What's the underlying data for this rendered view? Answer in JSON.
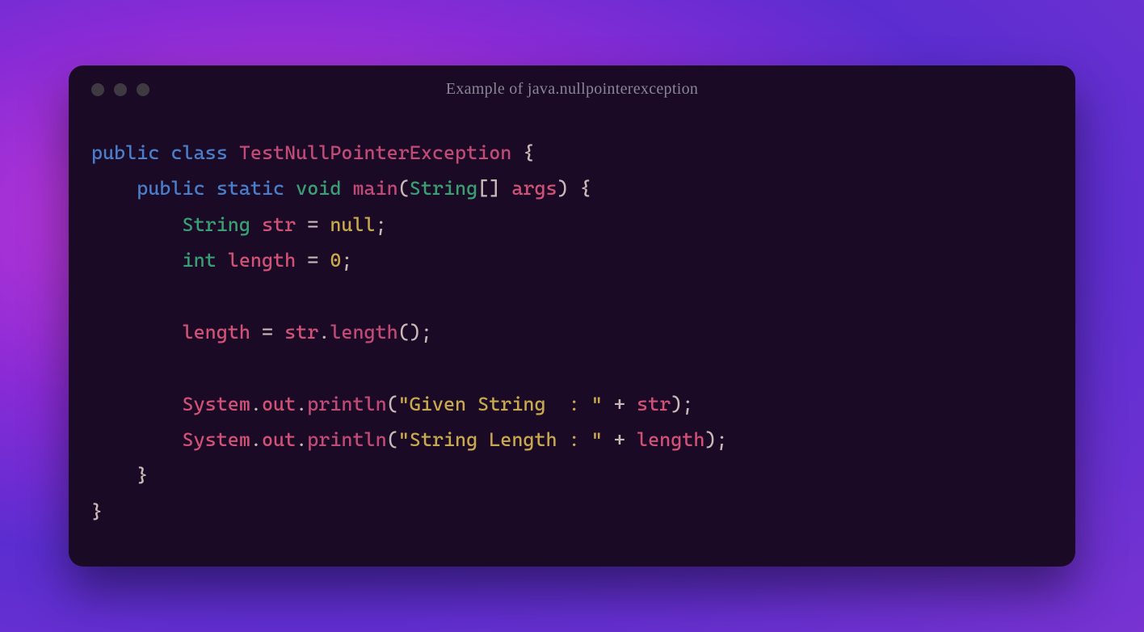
{
  "window": {
    "title": "Example of java.nullpointerexception"
  },
  "code": {
    "tokens": [
      [
        [
          "k",
          "public"
        ],
        [
          "pl",
          " "
        ],
        [
          "k",
          "class"
        ],
        [
          "pl",
          " "
        ],
        [
          "cl",
          "TestNullPointerException"
        ],
        [
          "pl",
          " "
        ],
        [
          "p",
          "{"
        ]
      ],
      [
        [
          "pl",
          "    "
        ],
        [
          "k",
          "public"
        ],
        [
          "pl",
          " "
        ],
        [
          "k",
          "static"
        ],
        [
          "pl",
          " "
        ],
        [
          "t",
          "void"
        ],
        [
          "pl",
          " "
        ],
        [
          "m",
          "main"
        ],
        [
          "p",
          "("
        ],
        [
          "t",
          "String"
        ],
        [
          "p",
          "[]"
        ],
        [
          "pl",
          " "
        ],
        [
          "id",
          "args"
        ],
        [
          "p",
          ")"
        ],
        [
          "pl",
          " "
        ],
        [
          "p",
          "{"
        ]
      ],
      [
        [
          "pl",
          "        "
        ],
        [
          "t",
          "String"
        ],
        [
          "pl",
          " "
        ],
        [
          "id",
          "str"
        ],
        [
          "pl",
          " "
        ],
        [
          "p",
          "="
        ],
        [
          "pl",
          " "
        ],
        [
          "n",
          "null"
        ],
        [
          "p",
          ";"
        ]
      ],
      [
        [
          "pl",
          "        "
        ],
        [
          "t",
          "int"
        ],
        [
          "pl",
          " "
        ],
        [
          "id",
          "length"
        ],
        [
          "pl",
          " "
        ],
        [
          "p",
          "="
        ],
        [
          "pl",
          " "
        ],
        [
          "n",
          "0"
        ],
        [
          "p",
          ";"
        ]
      ],
      [],
      [
        [
          "pl",
          "        "
        ],
        [
          "id",
          "length"
        ],
        [
          "pl",
          " "
        ],
        [
          "p",
          "="
        ],
        [
          "pl",
          " "
        ],
        [
          "id",
          "str"
        ],
        [
          "p",
          "."
        ],
        [
          "m",
          "length"
        ],
        [
          "p",
          "()"
        ],
        [
          "p",
          ";"
        ]
      ],
      [],
      [
        [
          "pl",
          "        "
        ],
        [
          "id",
          "System"
        ],
        [
          "p",
          "."
        ],
        [
          "id",
          "out"
        ],
        [
          "p",
          "."
        ],
        [
          "m",
          "println"
        ],
        [
          "p",
          "("
        ],
        [
          "s",
          "\"Given String  : \""
        ],
        [
          "pl",
          " "
        ],
        [
          "p",
          "+"
        ],
        [
          "pl",
          " "
        ],
        [
          "id",
          "str"
        ],
        [
          "p",
          ")"
        ],
        [
          "p",
          ";"
        ]
      ],
      [
        [
          "pl",
          "        "
        ],
        [
          "id",
          "System"
        ],
        [
          "p",
          "."
        ],
        [
          "id",
          "out"
        ],
        [
          "p",
          "."
        ],
        [
          "m",
          "println"
        ],
        [
          "p",
          "("
        ],
        [
          "s",
          "\"String Length : \""
        ],
        [
          "pl",
          " "
        ],
        [
          "p",
          "+"
        ],
        [
          "pl",
          " "
        ],
        [
          "id",
          "length"
        ],
        [
          "p",
          ")"
        ],
        [
          "p",
          ";"
        ]
      ],
      [
        [
          "pl",
          "    "
        ],
        [
          "p",
          "}"
        ]
      ],
      [
        [
          "p",
          "}"
        ]
      ]
    ]
  }
}
